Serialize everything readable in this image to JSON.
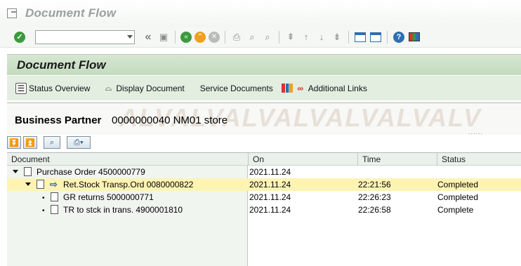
{
  "window": {
    "title": "Document Flow"
  },
  "toolbar": {
    "command_field_value": "",
    "icons": [
      "ok-icon",
      "dropdown-icon",
      "back-double-icon",
      "save-icon",
      "back-icon",
      "exit-icon",
      "cancel-icon",
      "print-icon",
      "find-icon",
      "find-next-icon",
      "first-page-icon",
      "previous-page-icon",
      "next-page-icon",
      "last-page-icon",
      "create-session-icon",
      "shortcut-icon",
      "help-icon",
      "layout-icon"
    ]
  },
  "section": {
    "title": "Document Flow"
  },
  "app_toolbar": {
    "status_overview": "Status Overview",
    "display_document": "Display Document",
    "service_documents": "Service Documents",
    "additional_links": "Additional Links"
  },
  "header": {
    "label": "Business Partner",
    "value": "0000000040 NM01 store",
    "watermark": "ALVALVALVALVALVALVALV"
  },
  "table": {
    "columns": {
      "document": "Document",
      "on": "On",
      "time": "Time",
      "status": "Status"
    },
    "rows": [
      {
        "document": "Purchase Order 4500000779",
        "on": "2021.11.24",
        "time": "",
        "status": ""
      },
      {
        "document": "Ret.Stock Transp.Ord 0080000822",
        "on": "2021.11.24",
        "time": "22:21:56",
        "status": "Completed"
      },
      {
        "document": "GR returns 5000000771",
        "on": "2021.11.24",
        "time": "22:26:23",
        "status": "Completed"
      },
      {
        "document": "TR to stck in trans. 4900001810",
        "on": "2021.11.24",
        "time": "22:26:58",
        "status": "Complete"
      }
    ]
  },
  "colors": {
    "selected_row": "#fdf4b4",
    "section_header": "#c4dbbf",
    "app_toolbar": "#e3eee0"
  }
}
